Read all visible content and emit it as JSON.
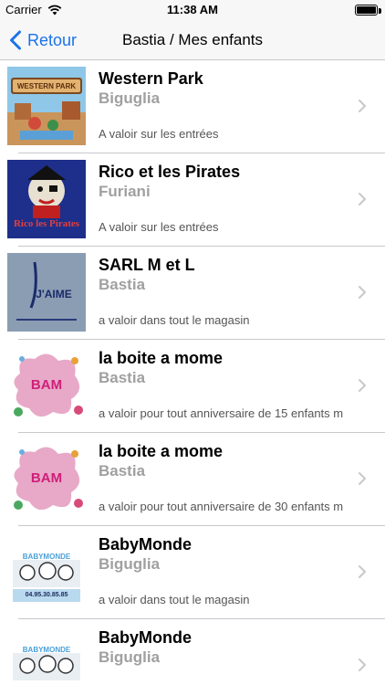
{
  "status_bar": {
    "carrier": "Carrier",
    "time": "11:38 AM",
    "battery_level": 1.0
  },
  "nav": {
    "back_label": "Retour",
    "title": "Bastia / Mes enfants",
    "accent_color": "#1a73e8"
  },
  "items": [
    {
      "title": "Western Park",
      "city": "Biguglia",
      "description": "A valoir sur les entrées",
      "thumb_text": "WESTERN PARK"
    },
    {
      "title": "Rico et les Pirates",
      "city": "Furiani",
      "description": "A valoir sur les entrées",
      "thumb_text": "Rico les Pirates"
    },
    {
      "title": "SARL M et L",
      "city": "Bastia",
      "description": "a valoir dans tout le magasin",
      "thumb_text": "J'AIME"
    },
    {
      "title": "la boite a mome",
      "city": "Bastia",
      "description": "a valoir pour tout anniversaire de 15 enfants m",
      "thumb_text": "BAM"
    },
    {
      "title": "la boite a mome",
      "city": "Bastia",
      "description": "a valoir pour tout anniversaire  de 30 enfants m",
      "thumb_text": "BAM"
    },
    {
      "title": "BabyMonde",
      "city": "Biguglia",
      "description": "a valoir dans tout le magasin",
      "thumb_text": "BABYMONDE",
      "thumb_phone": "04.95.30.85.85"
    },
    {
      "title": "BabyMonde",
      "city": "Biguglia",
      "description": "",
      "thumb_text": "BABYMONDE"
    }
  ]
}
